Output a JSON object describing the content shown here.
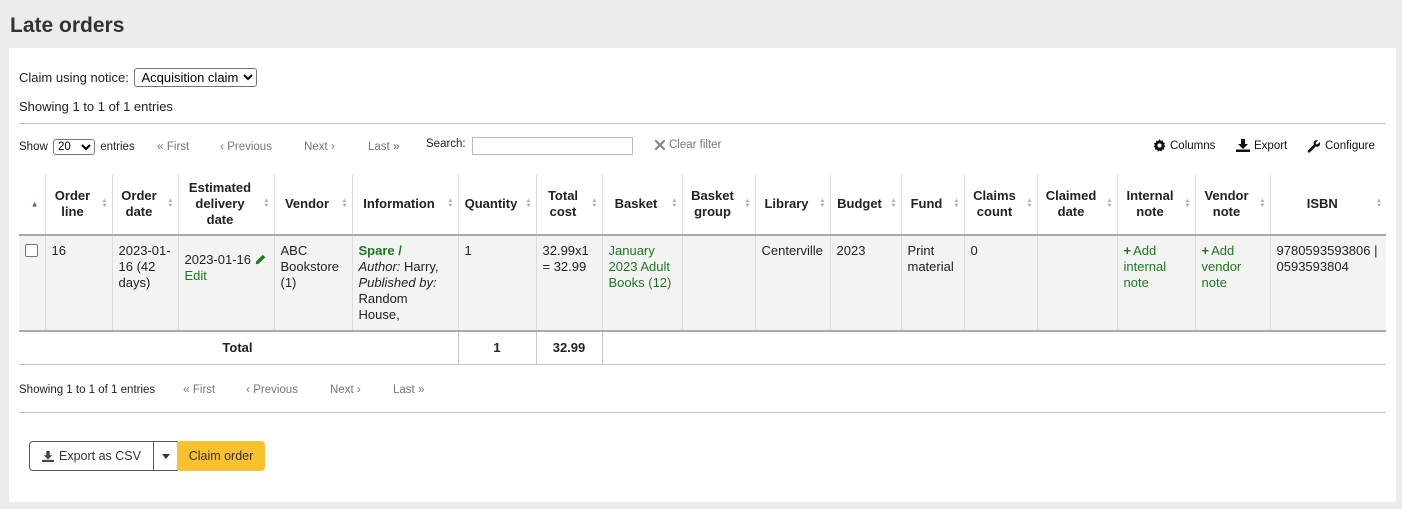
{
  "page": {
    "title": "Late orders"
  },
  "claim": {
    "label": "Claim using notice:",
    "selected": "Acquisition claim"
  },
  "showing_top": "Showing 1 to 1 of 1 entries",
  "toolbar": {
    "show_label": "Show",
    "show_value": "20",
    "entries_label": "entries",
    "first": "First",
    "previous": "Previous",
    "next": "Next",
    "last": "Last",
    "search_label": "Search:",
    "search_value": "",
    "clear_filter": "Clear filter",
    "columns": "Columns",
    "export": "Export",
    "configure": "Configure"
  },
  "table": {
    "headers": {
      "order_line": "Order line",
      "order_date": "Order date",
      "estimated_delivery_date": "Estimated delivery date",
      "vendor": "Vendor",
      "information": "Information",
      "quantity": "Quantity",
      "total_cost": "Total cost",
      "basket": "Basket",
      "basket_group": "Basket group",
      "library": "Library",
      "budget": "Budget",
      "fund": "Fund",
      "claims_count": "Claims count",
      "claimed_date": "Claimed date",
      "internal_note": "Internal note",
      "vendor_note": "Vendor note",
      "isbn": "ISBN"
    },
    "rows": [
      {
        "order_line": "16",
        "order_date": "2023-01-16 (42 days)",
        "estimated_delivery_date": "2023-01-16",
        "edit_label": "Edit",
        "vendor": "ABC Bookstore (1)",
        "info_title": "Spare /",
        "info_author_label": "Author:",
        "info_author": "Harry,",
        "info_published_label": "Published by:",
        "info_publisher": "Random House,",
        "quantity": "1",
        "total_cost": "32.99x1 = 32.99",
        "basket": "January 2023 Adult Books (12)",
        "basket_group": "",
        "library": "Centerville",
        "budget": "2023",
        "fund": "Print material",
        "claims_count": "0",
        "claimed_date": "",
        "internal_note_link": "Add internal note",
        "vendor_note_link": "Add vendor note",
        "isbn": "9780593593806 | 0593593804"
      }
    ],
    "footer": {
      "label": "Total",
      "quantity": "1",
      "total_cost": "32.99"
    }
  },
  "showing_bottom": "Showing 1 to 1 of 1 entries",
  "actions": {
    "export_csv": "Export as CSV",
    "claim_order": "Claim order"
  },
  "colors": {
    "link_green": "#1b7b1b",
    "claim_button": "#f8c12d",
    "sort_active": "#3b6db2"
  }
}
